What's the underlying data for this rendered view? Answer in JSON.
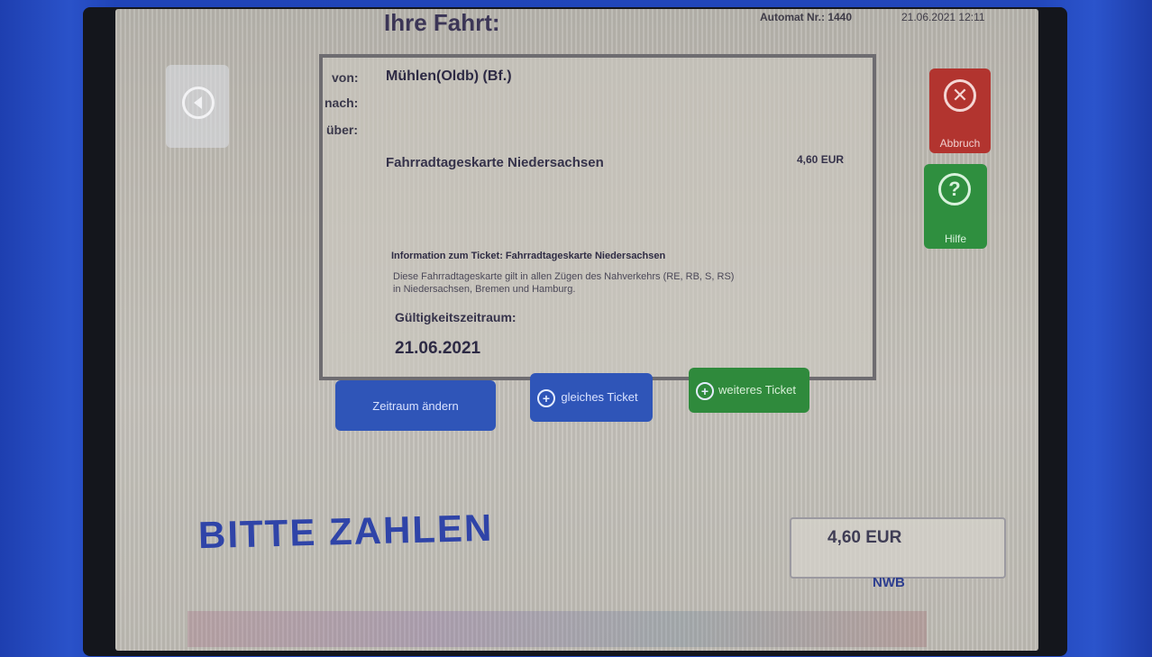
{
  "header": {
    "title": "Ihre Fahrt:",
    "machine_label": "Automat Nr.: 1440",
    "datetime": "21.06.2021 12:11"
  },
  "journey": {
    "from_label": "von:",
    "to_label": "nach:",
    "via_label": "über:",
    "from_value": "Mühlen(Oldb) (Bf.)",
    "ticket_name": "Fahrradtageskarte Niedersachsen",
    "ticket_price": "4,60 EUR"
  },
  "info": {
    "heading": "Information zum Ticket:   Fahrradtageskarte Niedersachsen",
    "text": "Diese Fahrradtageskarte gilt in allen Zügen des Nahverkehrs (RE, RB, S, RS) in Niedersachsen, Bremen und Hamburg.",
    "validity_label": "Gültigkeitszeitraum:",
    "validity_date": "21.06.2021"
  },
  "actions": {
    "change_period": "Zeitraum ändern",
    "same_ticket": "gleiches Ticket",
    "another_ticket": "weiteres Ticket",
    "cancel": "Abbruch",
    "help": "Hilfe"
  },
  "payment": {
    "prompt": "BITTE ZAHLEN",
    "amount": "4,60 EUR",
    "logo_text": "NWB"
  },
  "colors": {
    "housing_blue": "#2247bb",
    "action_blue": "#2f55b8",
    "action_green": "#2f8a3c",
    "cancel_red": "#b2342f"
  },
  "icons": {
    "back": "back-arrow-icon",
    "cancel": "close-icon",
    "help": "question-icon",
    "add": "plus-icon"
  }
}
